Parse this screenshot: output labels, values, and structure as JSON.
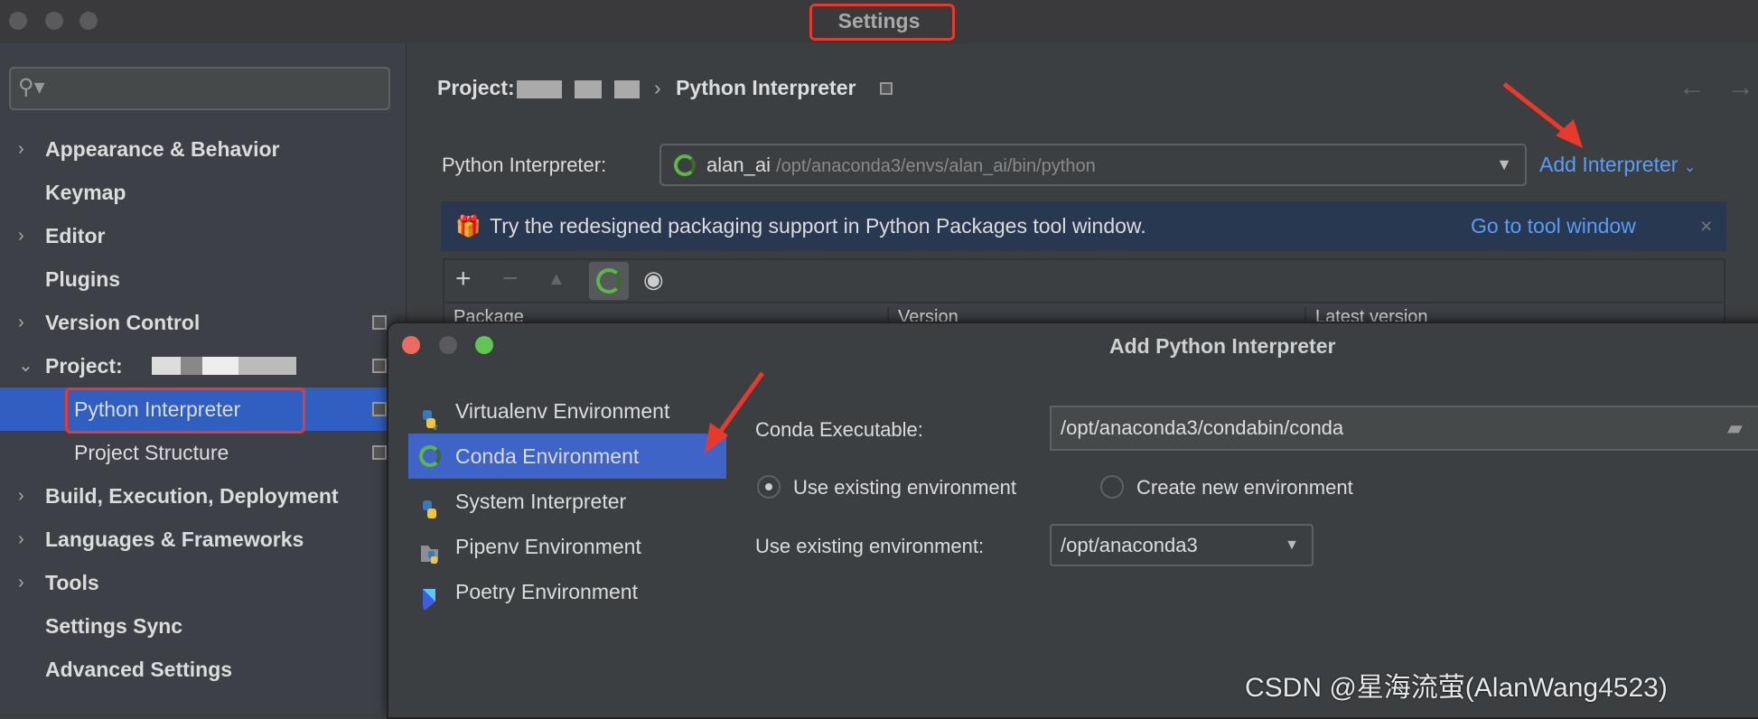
{
  "window": {
    "title": "Settings"
  },
  "sidebar": {
    "search_placeholder": "",
    "items": [
      {
        "label": "Appearance & Behavior",
        "expandable": true
      },
      {
        "label": "Keymap"
      },
      {
        "label": "Editor",
        "expandable": true
      },
      {
        "label": "Plugins"
      },
      {
        "label": "Version Control",
        "expandable": true
      },
      {
        "label": "Project:",
        "expandable": true,
        "expanded": true
      },
      {
        "label": "Python Interpreter",
        "selected": true
      },
      {
        "label": "Project Structure"
      },
      {
        "label": "Build, Execution, Deployment",
        "expandable": true
      },
      {
        "label": "Languages & Frameworks",
        "expandable": true
      },
      {
        "label": "Tools",
        "expandable": true
      },
      {
        "label": "Settings Sync"
      },
      {
        "label": "Advanced Settings"
      }
    ]
  },
  "main": {
    "breadcrumb": {
      "project": "Project:",
      "separator": "›",
      "page": "Python Interpreter"
    },
    "interpreter_label": "Python Interpreter:",
    "interpreter_name": "alan_ai",
    "interpreter_path": "/opt/anaconda3/envs/alan_ai/bin/python",
    "add_interpreter": "Add Interpreter",
    "banner": {
      "text": "Try the redesigned packaging support in Python Packages tool window.",
      "link": "Go to tool window",
      "close": "×"
    },
    "table_headers": [
      "Package",
      "Version",
      "Latest version"
    ]
  },
  "dialog": {
    "title": "Add Python Interpreter",
    "types": [
      {
        "label": "Virtualenv Environment",
        "icon": "python-virtualenv-icon"
      },
      {
        "label": "Conda Environment",
        "icon": "conda-icon",
        "selected": true
      },
      {
        "label": "System Interpreter",
        "icon": "python-icon"
      },
      {
        "label": "Pipenv Environment",
        "icon": "pipenv-icon"
      },
      {
        "label": "Poetry Environment",
        "icon": "poetry-icon"
      }
    ],
    "conda_exec_label": "Conda Executable:",
    "conda_exec_value": "/opt/anaconda3/condabin/conda",
    "radio_existing": "Use existing environment",
    "radio_new": "Create new environment",
    "selected_radio": "existing",
    "existing_env_label": "Use existing environment:",
    "existing_env_value": "/opt/anaconda3"
  },
  "watermark": "CSDN @星海流萤(AlanWang4523)",
  "colors": {
    "accent": "#589df6",
    "selection": "#2f5fc0",
    "annotation": "#e8392b"
  }
}
